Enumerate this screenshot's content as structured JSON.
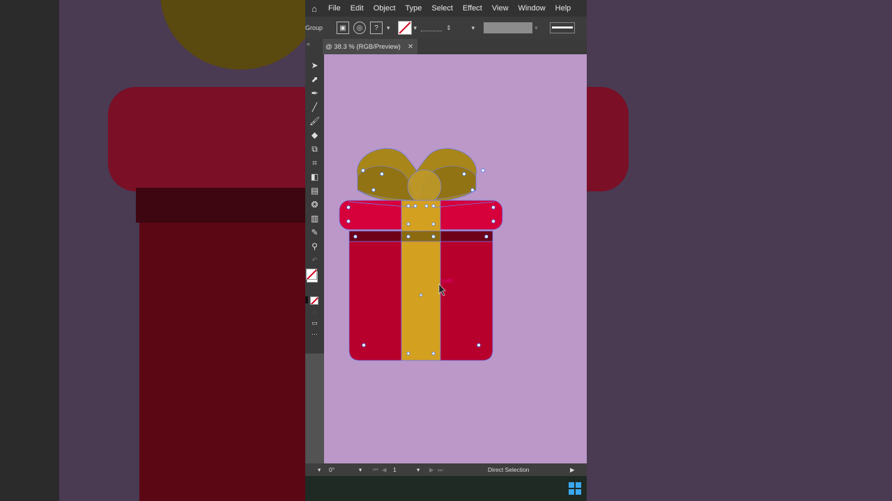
{
  "menu": {
    "items": [
      "File",
      "Edit",
      "Object",
      "Type",
      "Select",
      "Effect",
      "View",
      "Window",
      "Help"
    ]
  },
  "control_bar": {
    "selection_label": "Group",
    "stroke_weight": "",
    "stroke_dropdown": ""
  },
  "document_tab": {
    "title": "@ 38.3 % (RGB/Preview)",
    "close": "✕"
  },
  "hint": {
    "hover_label": "path"
  },
  "status_bar": {
    "rotation": "0°",
    "artboard_number": "1",
    "current_tool": "Direct Selection"
  },
  "colors": {
    "artboard": "#bb98c8",
    "box_red": "#b8002d",
    "lid_red": "#d6003a",
    "ribbon_gold": "#d4a020",
    "bow_gold": "#a8861a",
    "band_dark": "#6e0018",
    "anchor_blue": "#3a78ff"
  }
}
